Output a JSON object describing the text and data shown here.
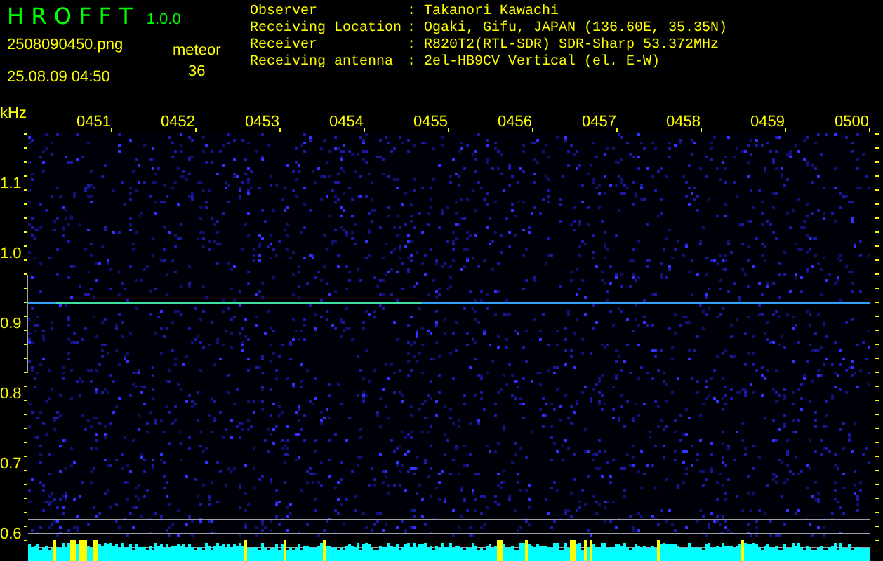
{
  "app": {
    "title": "H R O F F T",
    "version": "1.0.0"
  },
  "file_name": "2508090450.png",
  "timestamp": "25.08.09 04:50",
  "meteor": {
    "label": "meteor",
    "count": "36"
  },
  "station_info": [
    {
      "label": "Observer",
      "value": ": Takanori Kawachi"
    },
    {
      "label": "Receiving Location",
      "value": ": Ogaki, Gifu, JAPAN (136.60E, 35.35N)"
    },
    {
      "label": "Receiver",
      "value": ": R820T2(RTL-SDR) SDR-Sharp 53.372MHz"
    },
    {
      "label": "Receiving antenna",
      "value": ": 2el-HB9CV Vertical (el. E-W)"
    }
  ],
  "spectrogram": {
    "frequency_unit": "kHz",
    "time_labels": [
      "0451",
      "0452",
      "0453",
      "0454",
      "0455",
      "0456",
      "0457",
      "0458",
      "0459",
      "0500"
    ],
    "frequency_labels": [
      "1.1",
      "1.0",
      "0.9",
      "0.8",
      "0.7",
      "0.6"
    ]
  }
}
